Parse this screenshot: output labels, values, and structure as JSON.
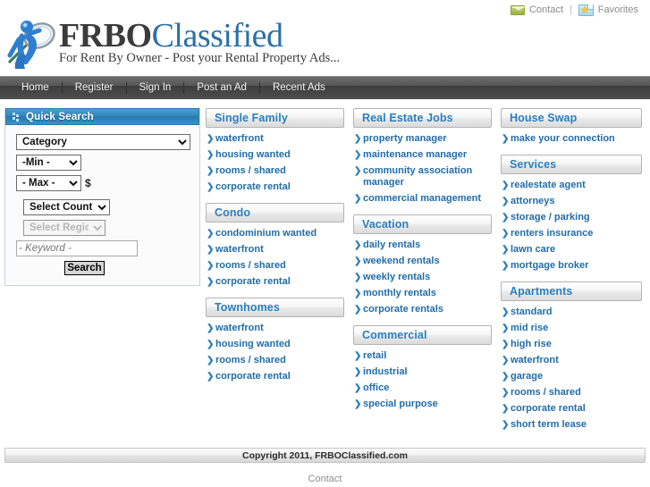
{
  "topbar": {
    "contact": {
      "label": "Contact",
      "icon": "envelope-icon"
    },
    "separator": "|",
    "favorites": {
      "label": "Favorites",
      "icon": "star-icon"
    }
  },
  "logo": {
    "title_bold": "FRBO",
    "title_light": "Classified",
    "tagline": "For Rent By Owner - Post your Rental Property Ads...",
    "mark_icon": "magnifier-person-icon"
  },
  "nav": {
    "items": [
      {
        "label": "Home"
      },
      {
        "label": "Register"
      },
      {
        "label": "Sign In"
      },
      {
        "label": "Post an Ad"
      },
      {
        "label": "Recent Ads"
      }
    ]
  },
  "quick_search": {
    "title": "Quick Search",
    "icon": "dots-icon",
    "category": {
      "value": "Category"
    },
    "min": {
      "value": "-Min -"
    },
    "max": {
      "value": "- Max -"
    },
    "currency": "$",
    "country": {
      "value": "Select Country"
    },
    "region": {
      "value": "Select Region"
    },
    "keyword": {
      "placeholder": "- Keyword -",
      "value": ""
    },
    "search_button": "Search"
  },
  "columns": [
    {
      "sections": [
        {
          "title": "Single Family",
          "links": [
            "waterfront",
            "housing wanted",
            "rooms / shared",
            "corporate rental"
          ]
        },
        {
          "title": "Condo",
          "links": [
            "condominium wanted",
            "waterfront",
            "rooms / shared",
            "corporate rental"
          ]
        },
        {
          "title": "Townhomes",
          "links": [
            "waterfront",
            "housing wanted",
            "rooms / shared",
            "corporate rental"
          ]
        }
      ]
    },
    {
      "sections": [
        {
          "title": "Real Estate Jobs",
          "links": [
            "property manager",
            "maintenance manager",
            "community association manager",
            "commercial management"
          ]
        },
        {
          "title": "Vacation",
          "links": [
            "daily rentals",
            "weekend rentals",
            "weekly rentals",
            "monthly rentals",
            "corporate rentals"
          ]
        },
        {
          "title": "Commercial",
          "links": [
            "retail",
            "industrial",
            "office",
            "special purpose"
          ]
        }
      ]
    },
    {
      "sections": [
        {
          "title": "House Swap",
          "links": [
            "make your connection"
          ]
        },
        {
          "title": "Services",
          "links": [
            "realestate agent",
            "attorneys",
            "storage / parking",
            "renters insurance",
            "lawn care",
            "mortgage broker"
          ]
        },
        {
          "title": "Apartments",
          "links": [
            "standard",
            "mid rise",
            "high rise",
            "waterfront",
            "garage",
            "rooms / shared",
            "corporate rental",
            "short term lease"
          ]
        }
      ]
    }
  ],
  "footer": {
    "copyright": "Copyright 2011, FRBOClassified.com",
    "contact_link": "Contact"
  },
  "colors": {
    "brand_blue": "#2c6fa8",
    "link_blue": "#1f6cab",
    "panel_header_blue": "#2f84b8",
    "nav_dark": "#4e4e4e"
  }
}
